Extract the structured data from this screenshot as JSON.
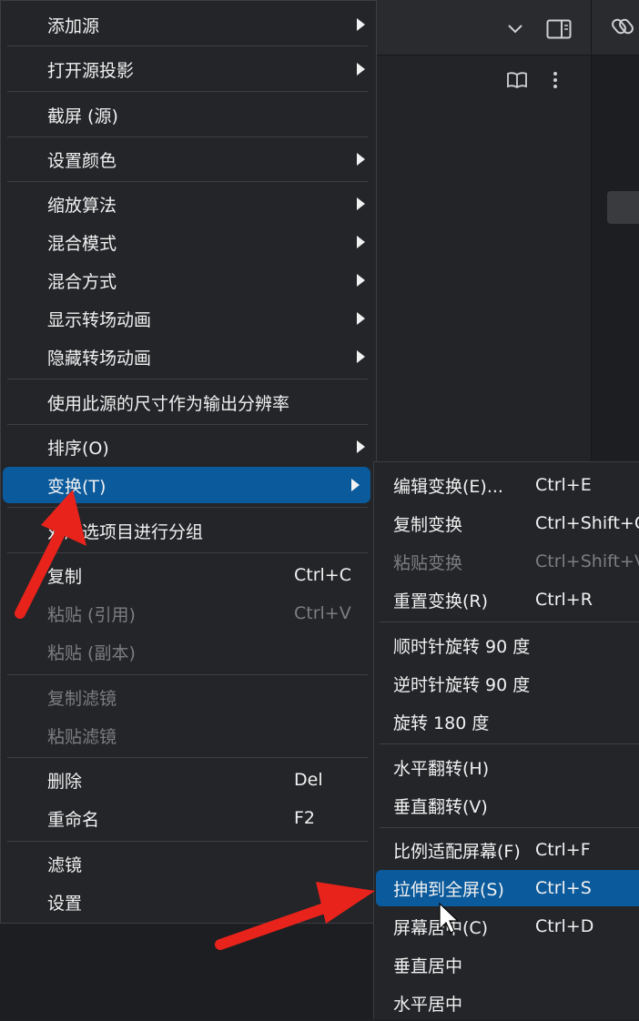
{
  "main_menu": {
    "items": [
      {
        "label": "添加源",
        "submenu": true
      },
      {
        "label": "打开源投影",
        "submenu": true
      },
      {
        "label": "截屏 (源)"
      },
      {
        "label": "设置颜色",
        "submenu": true
      },
      {
        "label": "缩放算法",
        "submenu": true
      },
      {
        "label": "混合模式",
        "submenu": true
      },
      {
        "label": "混合方式",
        "submenu": true
      },
      {
        "label": "显示转场动画",
        "submenu": true
      },
      {
        "label": "隐藏转场动画",
        "submenu": true
      },
      {
        "label": "使用此源的尺寸作为输出分辨率"
      },
      {
        "label": "排序(O)",
        "submenu": true
      },
      {
        "label": "变换(T)",
        "submenu": true,
        "highlighted": true
      },
      {
        "label": "对所选项目进行分组"
      },
      {
        "label": "复制",
        "shortcut": "Ctrl+C"
      },
      {
        "label": "粘贴 (引用)",
        "shortcut": "Ctrl+V",
        "disabled": true
      },
      {
        "label": "粘贴 (副本)",
        "disabled": true
      },
      {
        "label": "复制滤镜",
        "disabled": true
      },
      {
        "label": "粘贴滤镜",
        "disabled": true
      },
      {
        "label": "删除",
        "shortcut": "Del"
      },
      {
        "label": "重命名",
        "shortcut": "F2"
      },
      {
        "label": "滤镜"
      },
      {
        "label": "设置"
      }
    ]
  },
  "transform_submenu": {
    "items": [
      {
        "label": "编辑变换(E)...",
        "shortcut": "Ctrl+E"
      },
      {
        "label": "复制变换",
        "shortcut": "Ctrl+Shift+C"
      },
      {
        "label": "粘贴变换",
        "shortcut": "Ctrl+Shift+V",
        "disabled": true
      },
      {
        "label": "重置变换(R)",
        "shortcut": "Ctrl+R"
      },
      {
        "label": "顺时针旋转 90 度"
      },
      {
        "label": "逆时针旋转 90 度"
      },
      {
        "label": "旋转 180 度"
      },
      {
        "label": "水平翻转(H)"
      },
      {
        "label": "垂直翻转(V)"
      },
      {
        "label": "比例适配屏幕(F)",
        "shortcut": "Ctrl+F"
      },
      {
        "label": "拉伸到全屏(S)",
        "shortcut": "Ctrl+S",
        "highlighted": true
      },
      {
        "label": "屏幕居中(C)",
        "shortcut": "Ctrl+D"
      },
      {
        "label": "垂直居中"
      },
      {
        "label": "水平居中"
      }
    ]
  },
  "background_icons": [
    "chevron-down-icon",
    "sidebar-toggle-icon",
    "link-icon",
    "book-icon",
    "more-vertical-icon"
  ],
  "colors": {
    "menu_bg": "#232528",
    "highlight": "#0b5a9c",
    "disabled_text": "#7c7d80",
    "annotation_arrow": "#e8231c"
  }
}
